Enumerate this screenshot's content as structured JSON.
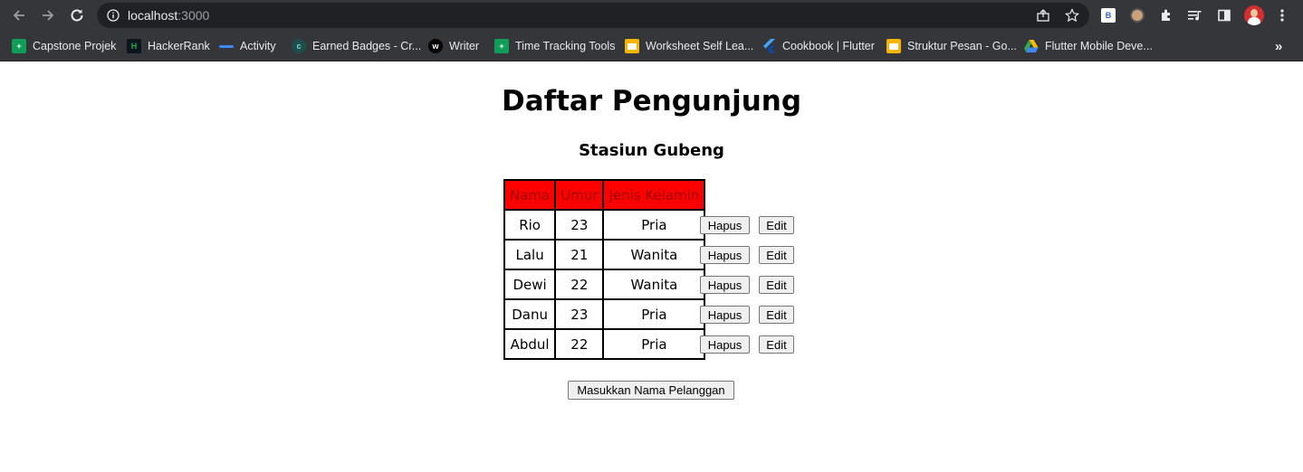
{
  "browser": {
    "url_host": "localhost",
    "url_port": ":3000",
    "bookmarks": [
      {
        "label": "Capstone Projek",
        "icon": "sheets-icon",
        "color": "#0f9d58"
      },
      {
        "label": "HackerRank",
        "icon": "hackerrank-icon",
        "color": "#1ba94c"
      },
      {
        "label": "Activity",
        "icon": "activity-icon",
        "color": "#4285f4"
      },
      {
        "label": "Earned Badges - Cr...",
        "icon": "credly-icon",
        "color": "#1f4d4d"
      },
      {
        "label": "Writer",
        "icon": "writer-icon",
        "color": "#000000"
      },
      {
        "label": "Time Tracking Tools",
        "icon": "sheets-icon",
        "color": "#0f9d58"
      },
      {
        "label": "Worksheet Self Lea...",
        "icon": "slides-icon",
        "color": "#f4b400"
      },
      {
        "label": "Cookbook | Flutter",
        "icon": "flutter-icon",
        "color": "#42a5f5"
      },
      {
        "label": "Struktur Pesan - Go...",
        "icon": "slides-icon",
        "color": "#f4b400"
      },
      {
        "label": "Flutter Mobile Deve...",
        "icon": "drive-icon",
        "color": "#34a853"
      }
    ],
    "ext_b_label": "B",
    "more_bookmarks": "»"
  },
  "page": {
    "title": "Daftar Pengunjung",
    "subtitle": "Stasiun Gubeng",
    "table": {
      "headers": [
        "Nama",
        "Umur",
        "Jenis Kelamin"
      ],
      "rows": [
        {
          "nama": "Rio",
          "umur": "23",
          "jk": "Pria"
        },
        {
          "nama": "Lalu",
          "umur": "21",
          "jk": "Wanita"
        },
        {
          "nama": "Dewi",
          "umur": "22",
          "jk": "Wanita"
        },
        {
          "nama": "Danu",
          "umur": "23",
          "jk": "Pria"
        },
        {
          "nama": "Abdul",
          "umur": "22",
          "jk": "Pria"
        }
      ]
    },
    "delete_label": "Hapus",
    "edit_label": "Edit",
    "add_label": "Masukkan Nama Pelanggan"
  }
}
